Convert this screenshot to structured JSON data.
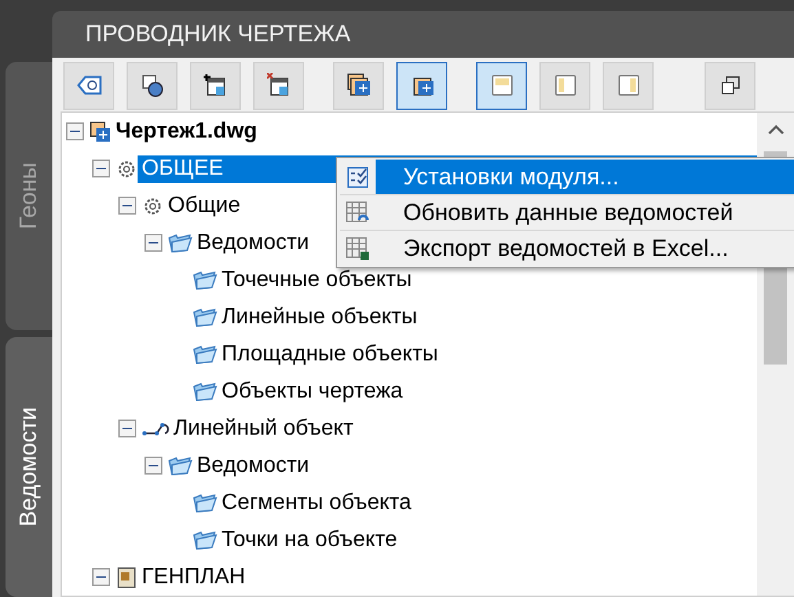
{
  "side_tabs": [
    {
      "label": "Геоны",
      "selected": false
    },
    {
      "label": "Ведомости",
      "selected": true
    }
  ],
  "panel": {
    "title": "ПРОВОДНИК ЧЕРТЕЖА"
  },
  "toolbar": [
    {
      "kind": "tag",
      "selected": false
    },
    {
      "kind": "shapes",
      "selected": false
    },
    {
      "kind": "add",
      "selected": false
    },
    {
      "kind": "remove",
      "selected": false
    },
    {
      "kind": "stack",
      "selected": false
    },
    {
      "kind": "single",
      "selected": true
    },
    {
      "kind": "split-h",
      "selected": true
    },
    {
      "kind": "split-l",
      "selected": false
    },
    {
      "kind": "split-r",
      "selected": false
    },
    {
      "kind": "windows",
      "selected": false
    }
  ],
  "tree": [
    {
      "label": "Чертеж1.dwg",
      "kind": "drawing",
      "selected": false,
      "expanded": true,
      "children": [
        {
          "label": "ОБЩЕЕ",
          "kind": "gear",
          "selected": true,
          "expanded": true,
          "children": [
            {
              "label": "Общие",
              "kind": "gear",
              "selected": false,
              "expanded": true,
              "children": [
                {
                  "label": "Ведомости",
                  "kind": "folder",
                  "selected": false,
                  "expanded": true,
                  "children": [
                    {
                      "label": "Точечные объекты",
                      "kind": "folder",
                      "selected": false
                    },
                    {
                      "label": "Линейные объекты",
                      "kind": "folder",
                      "selected": false
                    },
                    {
                      "label": "Площадные объекты",
                      "kind": "folder",
                      "selected": false
                    },
                    {
                      "label": "Объекты чертежа",
                      "kind": "folder",
                      "selected": false
                    }
                  ]
                }
              ]
            },
            {
              "label": "Линейный объект",
              "kind": "line",
              "selected": false,
              "expanded": true,
              "children": [
                {
                  "label": "Ведомости",
                  "kind": "folder",
                  "selected": false,
                  "expanded": true,
                  "children": [
                    {
                      "label": "Сегменты объекта",
                      "kind": "folder",
                      "selected": false
                    },
                    {
                      "label": "Точки на объекте",
                      "kind": "folder",
                      "selected": false
                    }
                  ]
                }
              ]
            }
          ]
        },
        {
          "label": "ГЕНПЛАН",
          "kind": "plan",
          "selected": false,
          "expanded": true
        }
      ]
    }
  ],
  "context_menu": [
    {
      "label": "Установки модуля...",
      "kind": "checklist",
      "selected": true
    },
    {
      "label": "Обновить данные ведомостей",
      "kind": "grid-refresh",
      "selected": false
    },
    {
      "label": "Экспорт ведомостей в Excel...",
      "kind": "grid-export",
      "selected": false
    }
  ]
}
